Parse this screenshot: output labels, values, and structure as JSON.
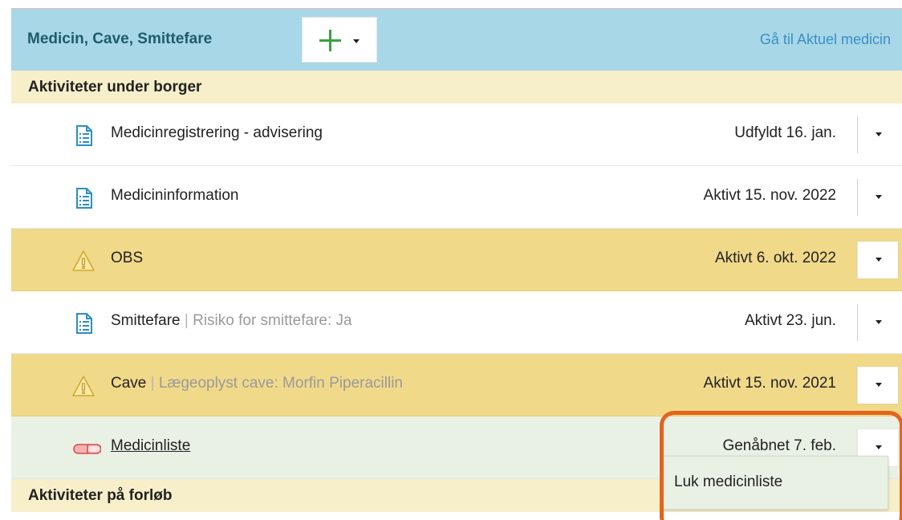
{
  "header": {
    "title": "Medicin, Cave, Smittefare",
    "link": "Gå til Aktuel medicin",
    "add_icon": "plus-icon",
    "add_caret_icon": "chevron-down-icon"
  },
  "section_borger": {
    "label": "Aktiviteter under borger"
  },
  "section_forloeb": {
    "label": "Aktiviteter på forløb"
  },
  "rows": [
    {
      "title": "Medicinregistrering - advisering",
      "sub": "",
      "status": "Udfyldt 16. jan.",
      "icon": "form-icon",
      "style": "white"
    },
    {
      "title": "Medicininformation",
      "sub": "",
      "status": "Aktivt 15. nov. 2022",
      "icon": "form-icon",
      "style": "white"
    },
    {
      "title": "OBS",
      "sub": "",
      "status": "Aktivt 6. okt. 2022",
      "icon": "warning-icon",
      "style": "yellow"
    },
    {
      "title": "Smittefare",
      "sub": "Risiko for smittefare: Ja",
      "status": "Aktivt 23. jun.",
      "icon": "form-icon",
      "style": "white"
    },
    {
      "title": "Cave",
      "sub": "Lægeoplyst cave: Morfin Piperacillin",
      "status": "Aktivt 15. nov. 2021",
      "icon": "warning-icon",
      "style": "yellow"
    },
    {
      "title": "Medicinliste",
      "sub": "",
      "status": "Genåbnet 7. feb.",
      "icon": "pill-icon",
      "style": "green"
    }
  ],
  "dropdown": {
    "item": "Luk medicinliste"
  },
  "colors": {
    "header_bg": "#a8d7e8",
    "section_bg": "#f7efc9",
    "warning_row_bg": "#f1d98a",
    "active_row_bg": "#e9f1e5",
    "highlight": "#e4641c",
    "link": "#3b8fc4"
  }
}
